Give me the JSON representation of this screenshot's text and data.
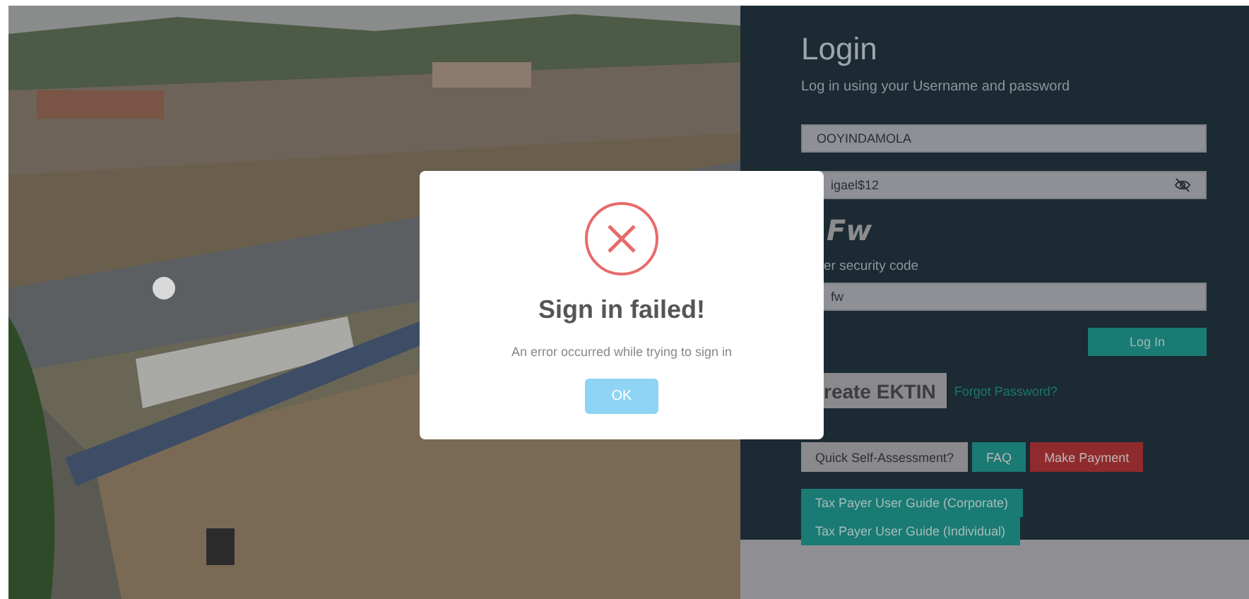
{
  "login": {
    "title": "Login",
    "subtitle": "Log in using your Username and password",
    "username": {
      "value": "OOYINDAMOLA"
    },
    "password": {
      "value": "igael$12"
    },
    "captcha": {
      "text": "Fw"
    },
    "captcha_label": "er security code",
    "captcha_field": {
      "value": "fw"
    },
    "login_button": "Log In",
    "create_button": "reate EKTIN",
    "forgot_link": "Forgot Password?",
    "actions": [
      {
        "label": "Quick Self-Assessment?",
        "kind": "plain"
      },
      {
        "label": "FAQ",
        "kind": "teal"
      },
      {
        "label": "Make Payment",
        "kind": "danger"
      }
    ],
    "guides": [
      "Tax Payer User Guide (Corporate)",
      "Tax Payer User Guide (Individual)"
    ]
  },
  "dialog": {
    "title": "Sign in failed!",
    "message": "An error occurred while trying to sign in",
    "button": "OK"
  }
}
